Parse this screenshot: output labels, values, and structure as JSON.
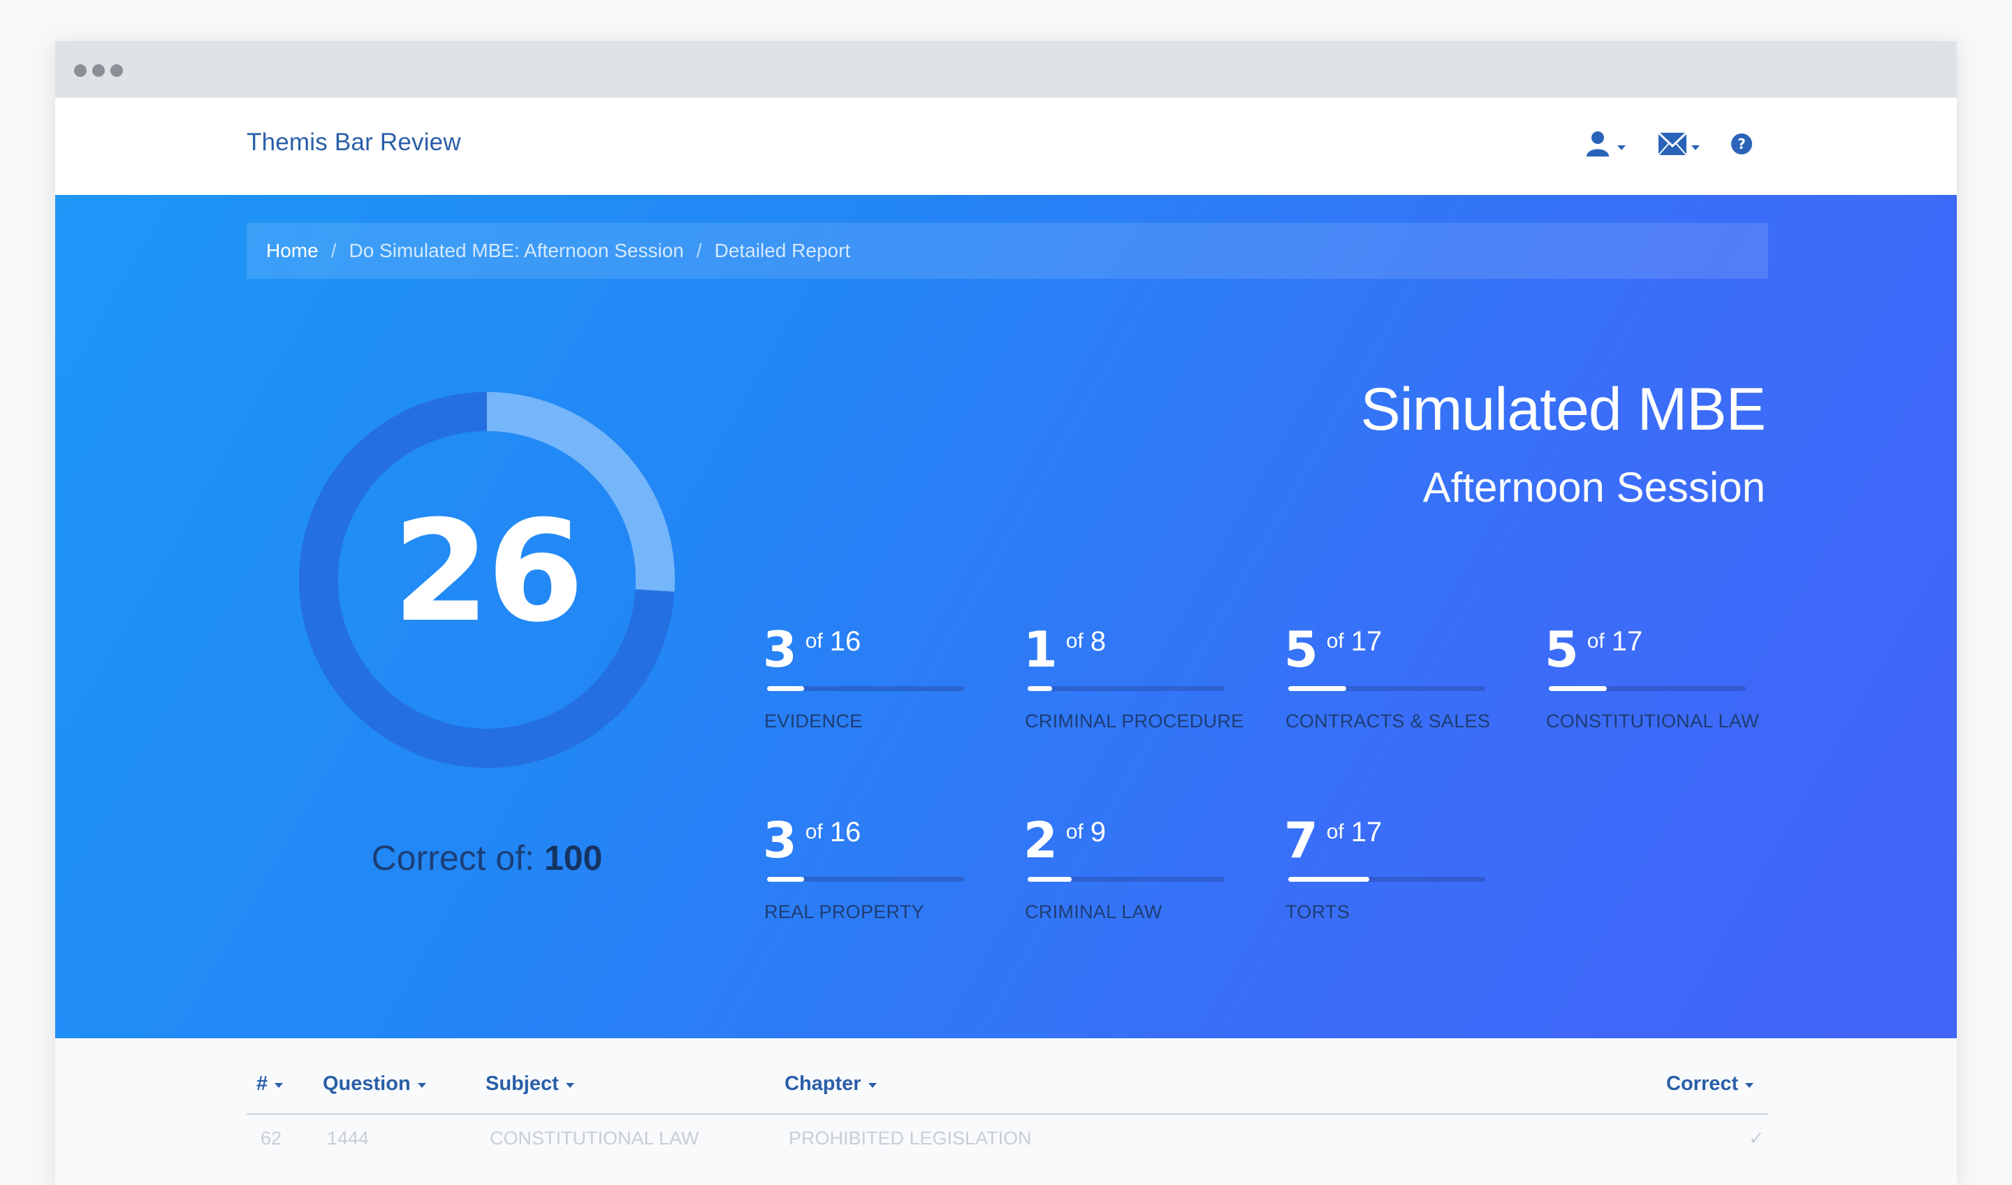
{
  "navbar": {
    "brand": "Themis Bar Review",
    "icons": [
      "user-icon",
      "mail-icon",
      "help-icon"
    ]
  },
  "breadcrumb": {
    "items": [
      "Home",
      "Do Simulated MBE: Afternoon Session",
      "Detailed Report"
    ],
    "separator": "/"
  },
  "score": {
    "value": "26",
    "correct_label": "Correct of:",
    "total": "100",
    "fraction": 0.26
  },
  "title": {
    "main": "Simulated MBE",
    "sub": "Afternoon Session"
  },
  "subjects": [
    {
      "correct": "3",
      "of": "of",
      "total": "16",
      "label": "EVIDENCE",
      "fraction": 0.1875
    },
    {
      "correct": "1",
      "of": "of",
      "total": "8",
      "label": "CRIMINAL PROCEDURE",
      "fraction": 0.125
    },
    {
      "correct": "5",
      "of": "of",
      "total": "17",
      "label": "CONTRACTS & SALES",
      "fraction": 0.294
    },
    {
      "correct": "5",
      "of": "of",
      "total": "17",
      "label": "CONSTITUTIONAL LAW",
      "fraction": 0.294
    },
    {
      "correct": "3",
      "of": "of",
      "total": "16",
      "label": "REAL PROPERTY",
      "fraction": 0.1875
    },
    {
      "correct": "2",
      "of": "of",
      "total": "9",
      "label": "CRIMINAL LAW",
      "fraction": 0.222
    },
    {
      "correct": "7",
      "of": "of",
      "total": "17",
      "label": "TORTS",
      "fraction": 0.412
    }
  ],
  "table": {
    "columns": [
      "#",
      "Question",
      "Subject",
      "Chapter",
      "Correct"
    ],
    "rows": [
      {
        "num": "62",
        "question": "1444",
        "subject": "CONSTITUTIONAL LAW",
        "chapter": "PROHIBITED LEGISLATION",
        "correct": "✓"
      }
    ]
  },
  "colors": {
    "brand": "#2a5fa8",
    "hero_start": "#1e97f7",
    "hero_end": "#4263f7",
    "ring_track": "#2470e0",
    "ring_progress": "#75b6fb"
  }
}
